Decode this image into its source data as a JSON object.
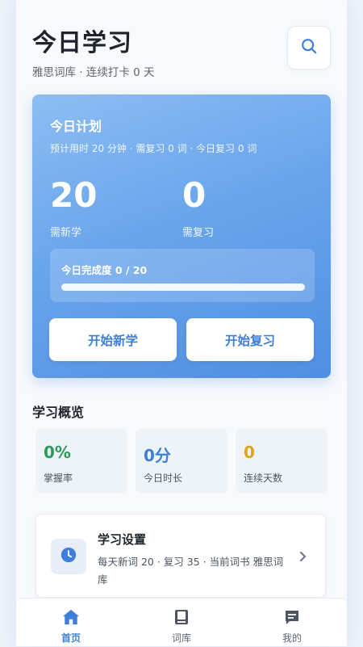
{
  "header": {
    "title": "今日学习",
    "subtitle": "雅思词库 · 连续打卡 0 天"
  },
  "plan": {
    "title": "今日计划",
    "description": "预计用时 20 分钟 · 需复习 0 词 · 今日复习 0 词",
    "new_count": "20",
    "new_label": "需新学",
    "review_count": "0",
    "review_label": "需复习",
    "progress_text": "今日完成度 0 / 20",
    "progress_fraction": 0,
    "start_new_label": "开始新学",
    "start_review_label": "开始复习"
  },
  "overview": {
    "title": "学习概览",
    "stats": [
      {
        "value": "0%",
        "label": "掌握率",
        "color": "#2e9a5a"
      },
      {
        "value": "0分",
        "label": "今日时长",
        "color": "#3e7fd9"
      },
      {
        "value": "0",
        "label": "连续天数",
        "color": "#e0a21c"
      }
    ]
  },
  "settings": {
    "title": "学习设置",
    "description": "每天新词 20 · 复习 35 · 当前词书 雅思词库"
  },
  "tabs": [
    {
      "label": "首页",
      "icon": "home-icon",
      "active": true
    },
    {
      "label": "词库",
      "icon": "book-icon",
      "active": false
    },
    {
      "label": "我的",
      "icon": "profile-message-icon",
      "active": false
    }
  ],
  "colors": {
    "accent": "#3e7fd9",
    "card_gradient_start": "#8dbdf3",
    "card_gradient_end": "#4f8fe2"
  }
}
